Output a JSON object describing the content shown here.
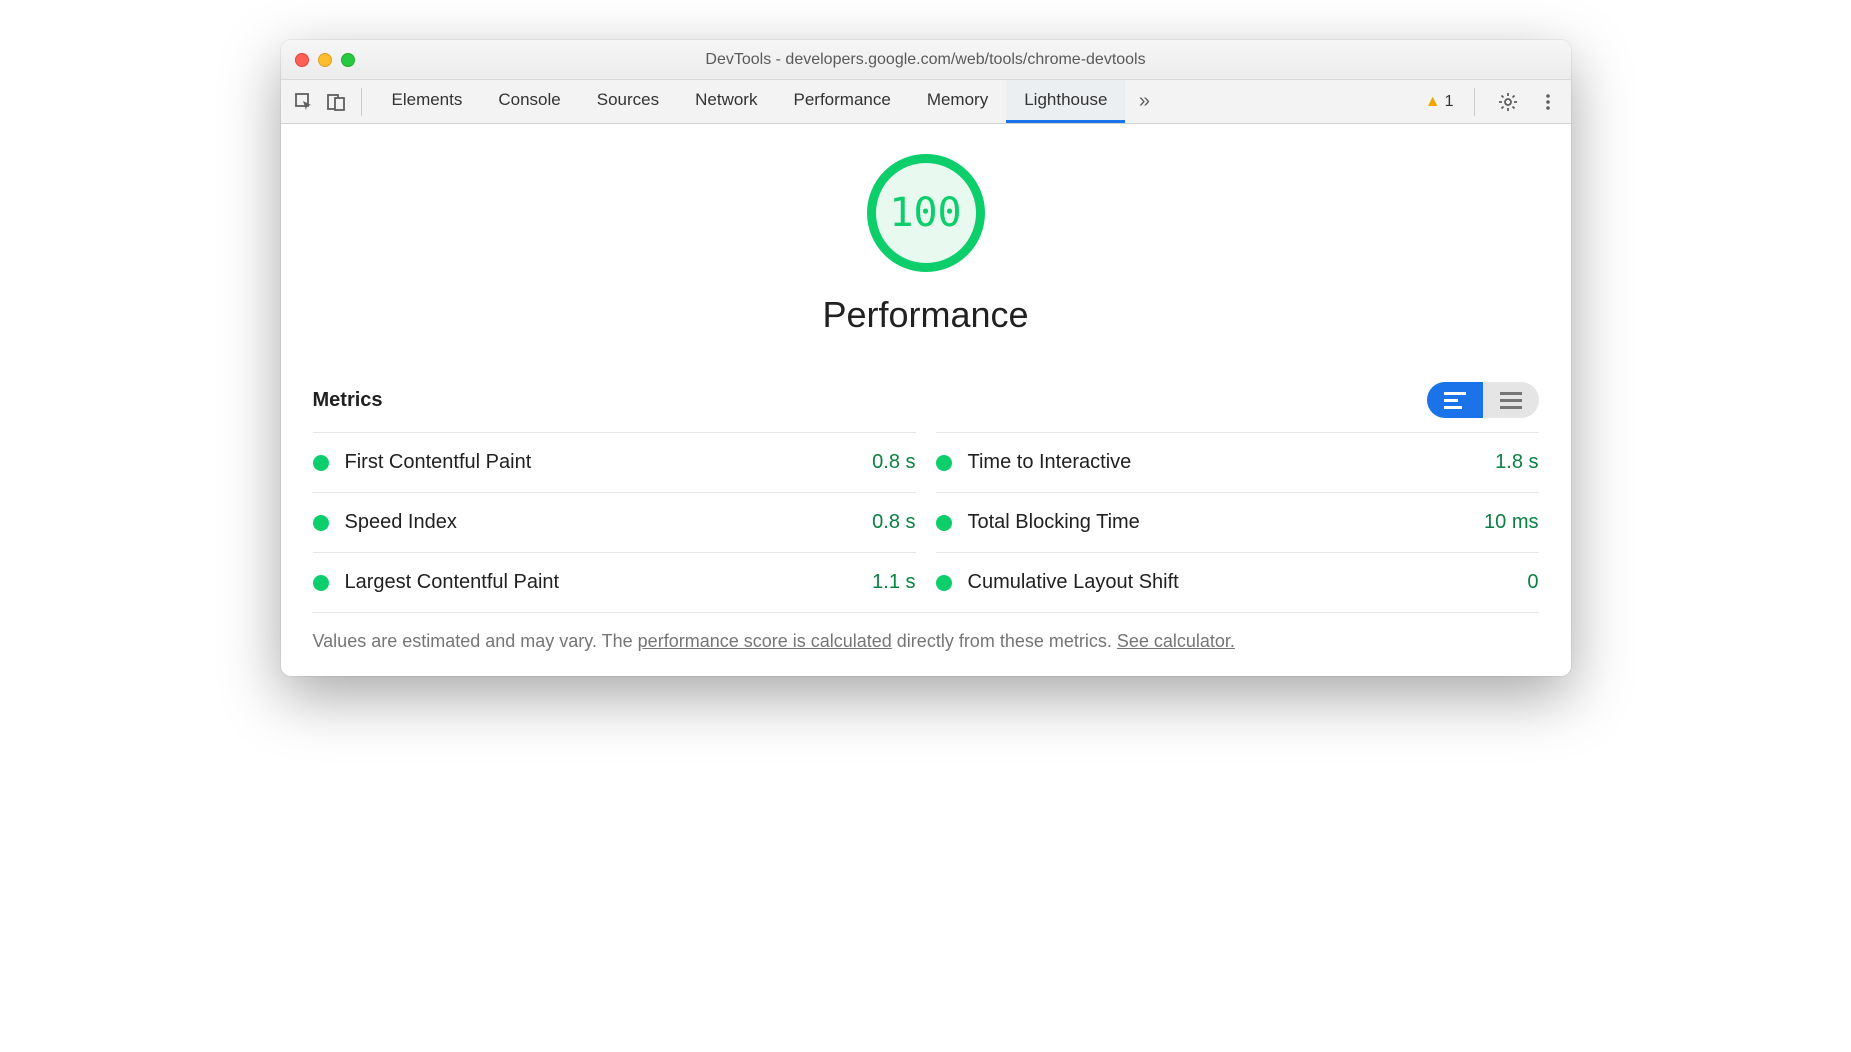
{
  "window": {
    "title": "DevTools - developers.google.com/web/tools/chrome-devtools"
  },
  "toolbar": {
    "tabs": [
      "Elements",
      "Console",
      "Sources",
      "Network",
      "Performance",
      "Memory",
      "Lighthouse"
    ],
    "active_tab": "Lighthouse",
    "warning_count": "1"
  },
  "lighthouse": {
    "score": "100",
    "category": "Performance",
    "metrics_heading": "Metrics",
    "metrics": [
      {
        "name": "First Contentful Paint",
        "value": "0.8 s"
      },
      {
        "name": "Time to Interactive",
        "value": "1.8 s"
      },
      {
        "name": "Speed Index",
        "value": "0.8 s"
      },
      {
        "name": "Total Blocking Time",
        "value": "10 ms"
      },
      {
        "name": "Largest Contentful Paint",
        "value": "1.1 s"
      },
      {
        "name": "Cumulative Layout Shift",
        "value": "0"
      }
    ],
    "footnote_pre": "Values are estimated and may vary. The ",
    "footnote_link1": "performance score is calculated",
    "footnote_mid": " directly from these metrics. ",
    "footnote_link2": "See calculator."
  },
  "colors": {
    "pass_green": "#0cce6b",
    "value_green": "#0b8043",
    "accent_blue": "#1a73e8"
  }
}
